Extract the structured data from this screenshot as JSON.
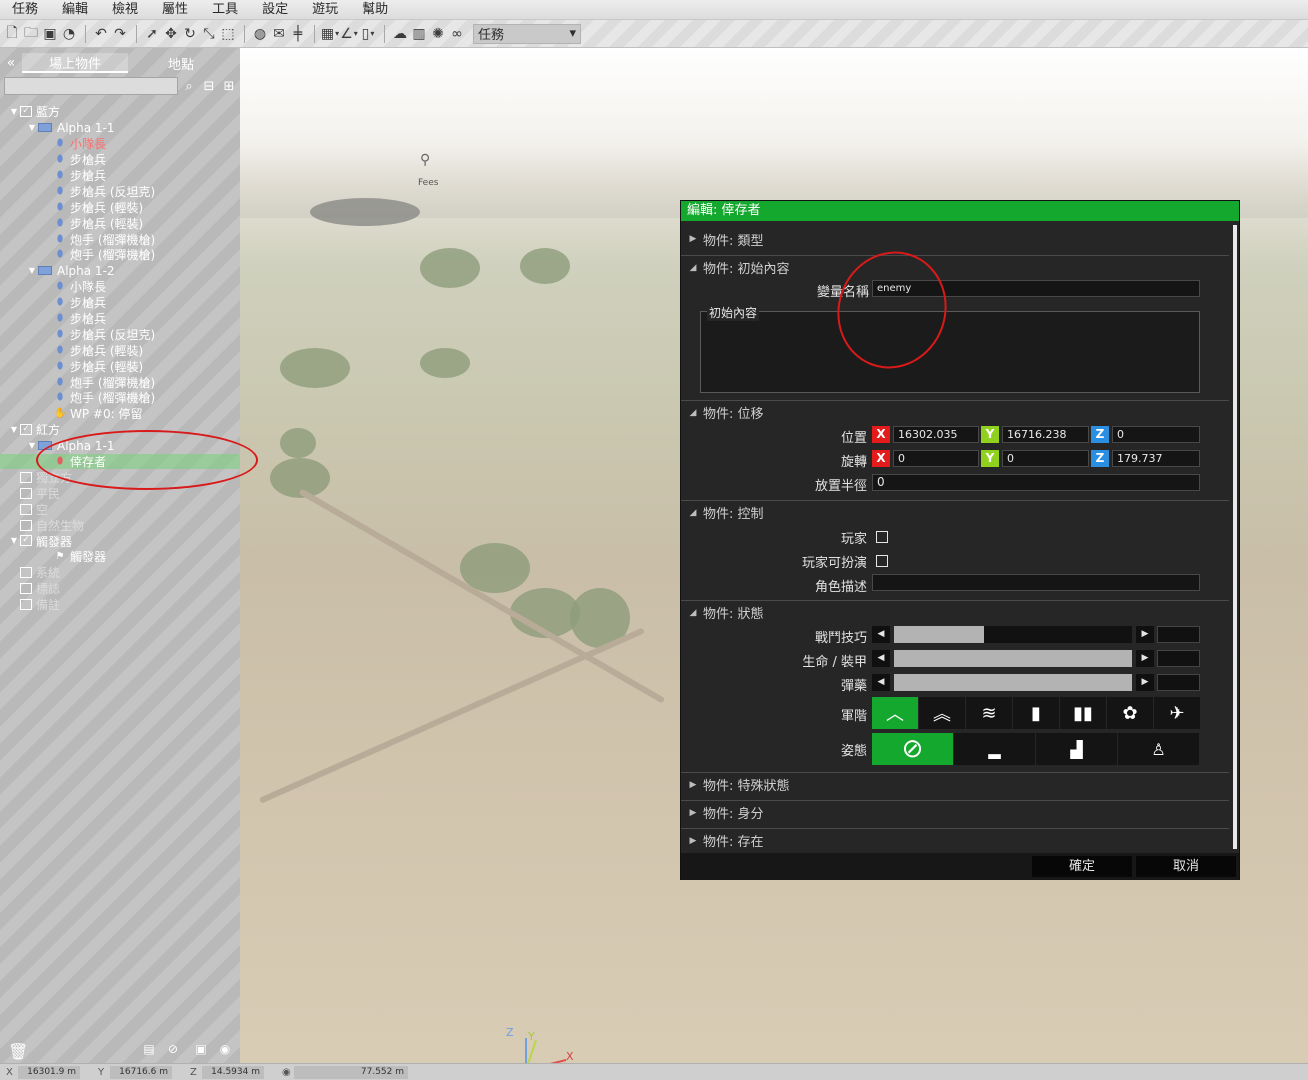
{
  "menu": [
    "任務",
    "編輯",
    "檢視",
    "屬性",
    "工具",
    "設定",
    "遊玩",
    "幫助"
  ],
  "toolbar": {
    "icons": [
      "new-file-icon",
      "open-folder-icon",
      "save-icon",
      "publish-icon",
      "undo-icon",
      "redo-icon",
      "select-cursor-icon",
      "translate-icon",
      "rotate-icon",
      "scale-icon",
      "area-select-icon",
      "globe-icon",
      "map-icon",
      "vertical-snap-icon",
      "grid-icon",
      "angle-icon",
      "sound-icon",
      "weather-icon",
      "environment-icon",
      "lighting-icon",
      "camera-icon"
    ],
    "mode_select": "任務"
  },
  "left_panel": {
    "tabs": [
      "場上物件",
      "地點"
    ],
    "active_tab": 0,
    "search_placeholder": "",
    "tree": [
      {
        "label": "藍方",
        "type": "side",
        "indent": 1,
        "check": "✓",
        "twisty": "▼"
      },
      {
        "label": "Alpha 1-1",
        "type": "group",
        "indent": 2,
        "twisty": "▼"
      },
      {
        "label": "小隊長",
        "type": "unit",
        "indent": 3,
        "highlight": true
      },
      {
        "label": "步槍兵",
        "type": "unit",
        "indent": 3
      },
      {
        "label": "步槍兵",
        "type": "unit",
        "indent": 3
      },
      {
        "label": "步槍兵 (反坦克)",
        "type": "unit",
        "indent": 3
      },
      {
        "label": "步槍兵 (輕裝)",
        "type": "unit",
        "indent": 3
      },
      {
        "label": "步槍兵 (輕裝)",
        "type": "unit",
        "indent": 3
      },
      {
        "label": "炮手 (榴彈機槍)",
        "type": "unit",
        "indent": 3
      },
      {
        "label": "炮手 (榴彈機槍)",
        "type": "unit",
        "indent": 3
      },
      {
        "label": "Alpha 1-2",
        "type": "group",
        "indent": 2,
        "twisty": "▼"
      },
      {
        "label": "小隊長",
        "type": "unit",
        "indent": 3
      },
      {
        "label": "步槍兵",
        "type": "unit",
        "indent": 3
      },
      {
        "label": "步槍兵",
        "type": "unit",
        "indent": 3
      },
      {
        "label": "步槍兵 (反坦克)",
        "type": "unit",
        "indent": 3
      },
      {
        "label": "步槍兵 (輕裝)",
        "type": "unit",
        "indent": 3
      },
      {
        "label": "步槍兵 (輕裝)",
        "type": "unit",
        "indent": 3
      },
      {
        "label": "炮手 (榴彈機槍)",
        "type": "unit",
        "indent": 3
      },
      {
        "label": "炮手 (榴彈機槍)",
        "type": "unit",
        "indent": 3
      },
      {
        "label": "WP #0: 停留",
        "type": "waypoint",
        "indent": 3
      },
      {
        "label": "紅方",
        "type": "side",
        "indent": 1,
        "check": "✓",
        "twisty": "▼"
      },
      {
        "label": "Alpha 1-1",
        "type": "group",
        "indent": 2,
        "twisty": "▼"
      },
      {
        "label": "倖存者",
        "type": "unit-red",
        "indent": 3,
        "selected": true
      },
      {
        "label": "獨立方",
        "type": "side",
        "indent": 1,
        "dim": true
      },
      {
        "label": "平民",
        "type": "side",
        "indent": 1,
        "dim": true
      },
      {
        "label": "空",
        "type": "side",
        "indent": 1,
        "dim": true
      },
      {
        "label": "自然生物",
        "type": "side",
        "indent": 1,
        "dim": true
      },
      {
        "label": "觸發器",
        "type": "side",
        "indent": 1,
        "check": "✓",
        "twisty": "▼"
      },
      {
        "label": "觸發器",
        "type": "trigger",
        "indent": 3
      },
      {
        "label": "系統",
        "type": "side",
        "indent": 1,
        "dim": true
      },
      {
        "label": "標誌",
        "type": "side",
        "indent": 1,
        "dim": true
      },
      {
        "label": "備註",
        "type": "side",
        "indent": 1,
        "dim": true
      }
    ]
  },
  "statusbar": {
    "x": {
      "label": "X",
      "value": "16301.9 m"
    },
    "y": {
      "label": "Y",
      "value": "16716.6 m"
    },
    "z": {
      "label": "Z",
      "value": "14.5934 m"
    },
    "view": {
      "label": "◉",
      "value": "77.552 m"
    }
  },
  "viewport": {
    "map_marker_label": "Fees",
    "axis": {
      "x": "X",
      "y": "Y",
      "z": "Z"
    }
  },
  "dialog": {
    "title": "編輯: 倖存者",
    "sections": {
      "type": "物件: 類型",
      "init": "物件: 初始內容",
      "transform": "物件: 位移",
      "control": "物件: 控制",
      "state": "物件: 狀態",
      "special": "物件: 特殊狀態",
      "identity": "物件: 身分",
      "presence": "物件: 存在"
    },
    "init": {
      "var_label": "變量名稱",
      "var_value": "enemy",
      "init_label": "初始內容",
      "init_value": ""
    },
    "transform": {
      "pos_label": "位置",
      "pos": {
        "x": "16302.035",
        "y": "16716.238",
        "z": "0"
      },
      "rot_label": "旋轉",
      "rot": {
        "x": "0",
        "y": "0",
        "z": "179.737"
      },
      "radius_label": "放置半徑",
      "radius": "0",
      "x": "X",
      "y": "Y",
      "z": "Z"
    },
    "control": {
      "player_label": "玩家",
      "playable_label": "玩家可扮演",
      "desc_label": "角色描述",
      "desc_value": "",
      "player_checked": false,
      "playable_checked": false
    },
    "state": {
      "skill_label": "戰鬥技巧",
      "skill_value": 0.38,
      "health_label": "生命 / 裝甲",
      "health_value": 1.0,
      "ammo_label": "彈藥",
      "ammo_value": 1.0,
      "rank_label": "軍階",
      "ranks": [
        "private-rank-icon",
        "corporal-rank-icon",
        "sergeant-rank-icon",
        "lieutenant-rank-icon",
        "captain-rank-icon",
        "major-rank-icon",
        "colonel-rank-icon"
      ],
      "rank_selected": 0,
      "stance_label": "姿態",
      "stances": [
        "auto-stance-icon",
        "prone-stance-icon",
        "crouch-stance-icon",
        "stand-stance-icon"
      ],
      "stance_selected": 0
    },
    "buttons": {
      "ok": "確定",
      "cancel": "取消"
    }
  },
  "colors": {
    "accent_green": "#14a82e",
    "axis_x": "#e31b1b",
    "axis_y": "#8fd11c",
    "axis_z": "#2a8fe0",
    "annotation_red": "#d91a1a"
  }
}
